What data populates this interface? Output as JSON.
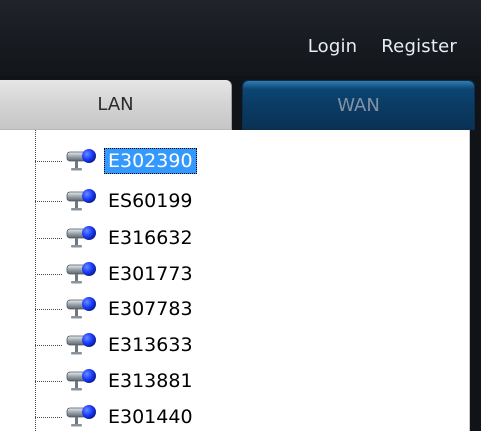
{
  "header": {
    "login_label": "Login",
    "register_label": "Register"
  },
  "tabs": [
    {
      "label": "LAN",
      "active": true
    },
    {
      "label": "WAN",
      "active": false
    }
  ],
  "device_tree": {
    "icon": "ip-camera-icon",
    "selected_index": 0,
    "items": [
      {
        "label": "E302390"
      },
      {
        "label": "ES60199"
      },
      {
        "label": "E316632"
      },
      {
        "label": "E301773"
      },
      {
        "label": "E307783"
      },
      {
        "label": "E313633"
      },
      {
        "label": "E313881"
      },
      {
        "label": "E301440"
      }
    ]
  },
  "colors": {
    "selection": "#3399ff",
    "wan_tab": "#0b3a62",
    "camera_ball": "#1a3cff"
  }
}
